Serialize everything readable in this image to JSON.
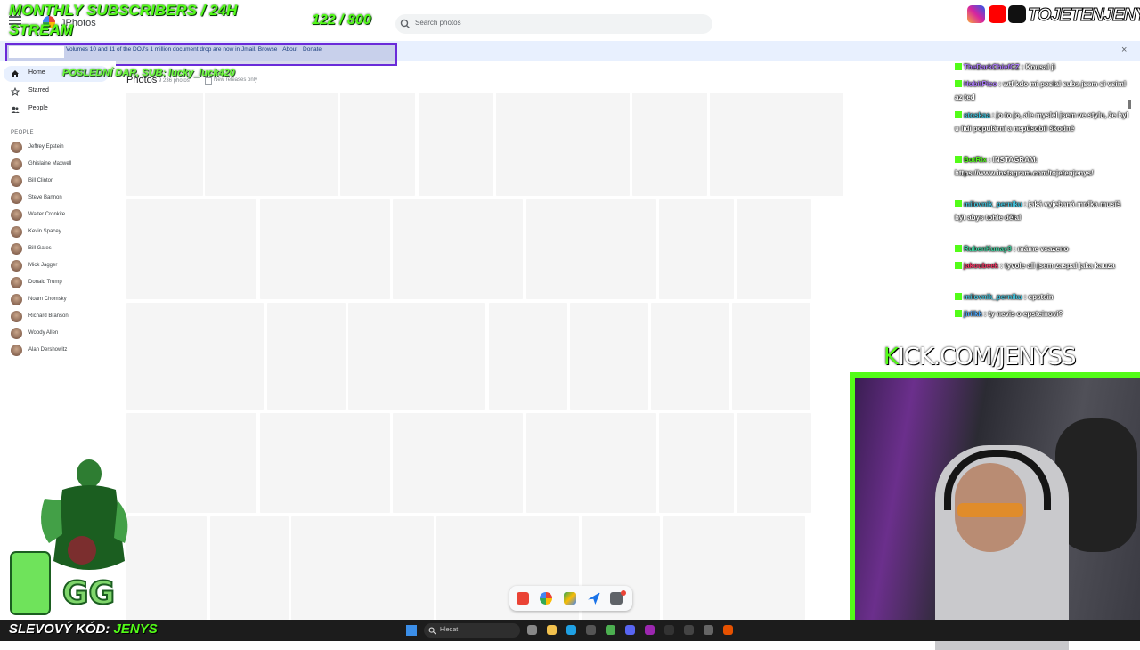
{
  "app": {
    "title": "JPhotos"
  },
  "search": {
    "placeholder": "Search photos"
  },
  "banner": {
    "text": "Volumes 10 and 11 of the DOJ's 1 million document drop are now in Jmail. Browse",
    "about": "About",
    "donate": "Donate",
    "close": "×"
  },
  "sidebar": {
    "nav": [
      {
        "label": "Home",
        "icon": "home-icon",
        "active": true
      },
      {
        "label": "Starred",
        "icon": "star-icon",
        "active": false
      },
      {
        "label": "People",
        "icon": "people-icon",
        "active": false
      }
    ],
    "people_heading": "PEOPLE",
    "people": [
      "Jeffrey Epstein",
      "Ghislaine Maxwell",
      "Bill Clinton",
      "Steve Bannon",
      "Walter Cronkite",
      "Kevin Spacey",
      "Bill Gates",
      "Mick Jagger",
      "Donald Trump",
      "Noam Chomsky",
      "Richard Branson",
      "Woody Allen",
      "Alan Dershowitz"
    ]
  },
  "main": {
    "title": "Photos",
    "count": "9 236 photos",
    "new_releases": "New releases only"
  },
  "overlay": {
    "sub_line1": "MONTHLY SUBSCRIBERS / 24H",
    "sub_line2": "STREAM",
    "sub_count": "122  / 800",
    "last_sub": "POSLEDNÍ DAR, SUB: lucky_luck420",
    "kick_k": "K",
    "kick_rest": "ICK.COM/JENYSS",
    "handle": "TOJETENJENYS",
    "code_label": "SLEVOVÝ KÓD:",
    "code_value": "JENYS"
  },
  "chat": [
    {
      "user": "TheDarkChiefCZ",
      "color": "#b07cff",
      "text": ": Kousal ji"
    },
    {
      "user": "HobitPico",
      "color": "#b07cff",
      "text": ": wtf kdo mi poslal suba jsem si vsiml az ted"
    },
    {
      "user": "stoskaa",
      "color": "#42c6e0",
      "text": ": jo to jo, ale myslel jsem ve stylu, že byl u lidí populární a nepůsobil škodně"
    },
    {
      "user": "BotRix",
      "color": "#53fc18",
      "text": ": INSTAGRAM: https://www.instagram.com/tojetenjenys/"
    },
    {
      "user": "milovnik_perniku",
      "color": "#42c6e0",
      "text": ": jaká vyjebaná mrdka musíš být abys tohle dělal"
    },
    {
      "user": "RubenKunay3",
      "color": "#3dd6a0",
      "text": ": máme vsazeno"
    },
    {
      "user": "jakoubeek",
      "color": "#ff3a6a",
      "text": ": tyvole ali jsem zaspal jaka kauza"
    },
    {
      "user": "milovnik_perniku",
      "color": "#42c6e0",
      "text": ": epstein"
    },
    {
      "user": "jirilkk",
      "color": "#4aa8ff",
      "text": ": ty nevis o epsteinovi?"
    }
  ],
  "taskbar": {
    "search_placeholder": "Hledat"
  },
  "colors": {
    "kick_green": "#53fc18",
    "accent_blue": "#1a73e8",
    "banner_frame": "#6a2bd9"
  }
}
